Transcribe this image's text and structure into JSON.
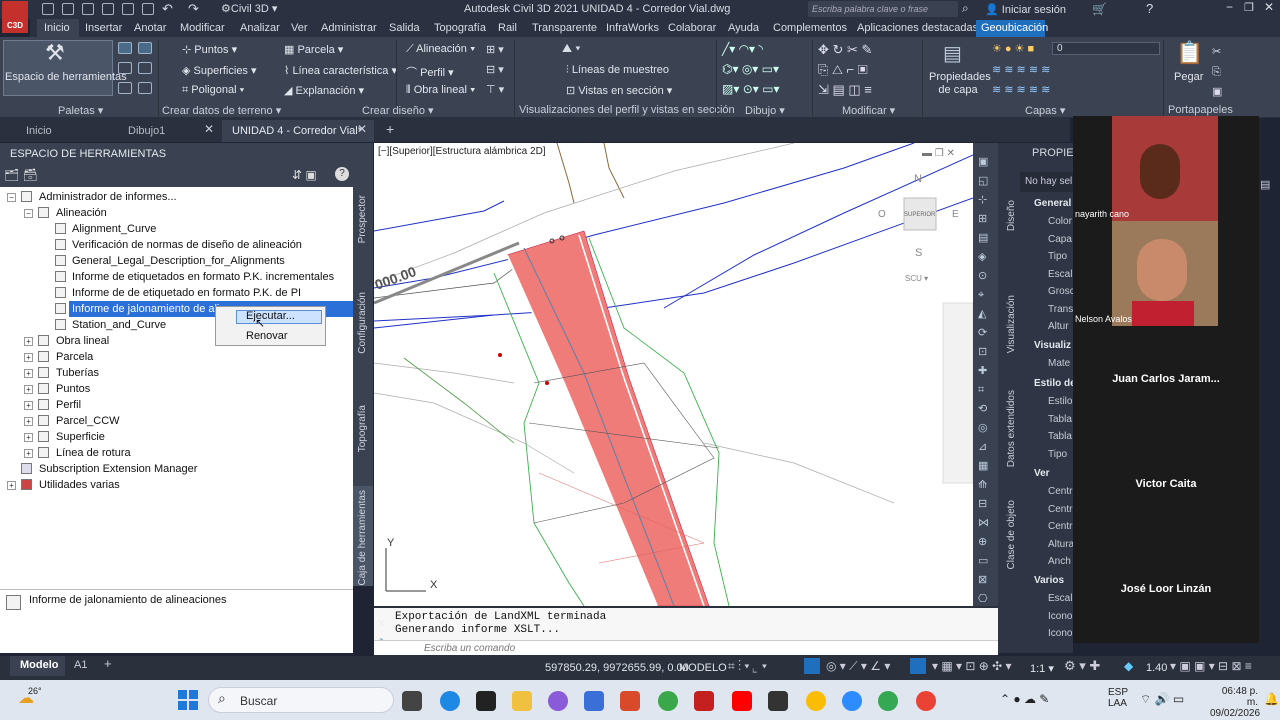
{
  "app": {
    "title": "Autodesk Civil 3D 2021   UNIDAD 4  - Corredor Vial.dwg",
    "workspace": "Civil 3D",
    "search_placeholder": "Escriba palabra clave o frase",
    "signin": "Iniciar sesión",
    "logo": "C3D"
  },
  "menu_tabs": [
    "Inicio",
    "Insertar",
    "Anotar",
    "Modificar",
    "Analizar",
    "Ver",
    "Administrar",
    "Salida",
    "Topografía",
    "Rail",
    "Transparente",
    "InfraWorks",
    "Colaborar",
    "Ayuda",
    "Complementos",
    "Aplicaciones destacadas",
    "Geoubicación"
  ],
  "ribbon": {
    "toolspace_button": "Espacio de herramientas",
    "paletas": "Paletas",
    "crear_datos": {
      "items": [
        "Puntos",
        "Superficies",
        "Poligonal",
        "Parcela",
        "Línea característica",
        "Explanación"
      ],
      "footer": "Crear datos de terreno"
    },
    "crear_diseno": {
      "items": [
        "Alineación",
        "Perfil",
        "Obra lineal"
      ],
      "footer": "Crear diseño"
    },
    "visualizaciones": {
      "items": [
        "Líneas de muestreo",
        "Vistas en sección"
      ],
      "footer": "Visualizaciones del perfil y vistas en sección"
    },
    "dibujo": "Dibujo",
    "modificar": "Modificar",
    "capas": {
      "button": "Propiedades de capa",
      "footer": "Capas",
      "layer_value": "0"
    },
    "portapapeles": {
      "button": "Pegar",
      "footer": "Portapapeles"
    }
  },
  "doc_tabs": [
    "Inicio",
    "Dibujo1",
    "UNIDAD 4  - Corredor Vial*"
  ],
  "toolspace": {
    "header": "ESPACIO DE HERRAMIENTAS",
    "tree": {
      "root": "Administrador de informes...",
      "alineacion": "Alineación",
      "alignment_reports": [
        "Alignment_Curve",
        "Verificación de normas de diseño de alineación",
        "General_Legal_Description_for_Alignments",
        "Informe de etiquetados en formato P.K. incrementales",
        "Informe de de etiquetado en formato P.K. de PI",
        "Informe de jalonamiento de alineaciones",
        "Station_and_Curve"
      ],
      "categories": [
        "Obra lineal",
        "Parcela",
        "Tuberías",
        "Puntos",
        "Perfil",
        "Parcel_CCW",
        "Superficie",
        "Línea de rotura"
      ],
      "subscription": "Subscription Extension Manager",
      "utilidades": "Utilidades varias"
    },
    "selected_visible": "Informe de jalonamiento de alin",
    "context_menu": [
      "Ejecutar...",
      "Renovar"
    ],
    "description": "Informe de jalonamiento de alineaciones",
    "side_tabs": [
      "Prospector",
      "Configuración",
      "Topografía",
      "Caja de herramientas"
    ]
  },
  "viewport": {
    "label": "[−][Superior][Estructura alámbrica 2D]",
    "station_text": "000.00",
    "viewcube": {
      "top": "SUPERIOR",
      "n": "N",
      "s": "S",
      "e": "E",
      "o": "O",
      "ucs": "SCU"
    },
    "axis_y": "Y",
    "axis_x": "X"
  },
  "command": {
    "history": [
      "Exportación de LandXML terminada",
      "Generando informe XSLT..."
    ],
    "placeholder": "Escriba un comando"
  },
  "properties": {
    "title": "PROPIED",
    "no_selection": "No hay sel",
    "side_tabs": [
      "Diseño",
      "Visualización",
      "Datos extendidos",
      "Clase de objeto"
    ],
    "sections": [
      {
        "name": "General",
        "rows": [
          "Color",
          "Capa",
          "Tipo",
          "Escal",
          "Grosc",
          "Trans",
          "Altur"
        ]
      },
      {
        "name": "Visualiz",
        "rows": [
          "Mate"
        ]
      },
      {
        "name": "Estilo de",
        "rows": [
          "Estilo",
          "Tabla",
          "Tabla",
          "Tipo"
        ]
      },
      {
        "name": "Ver",
        "rows": [
          "Centr",
          "Centr",
          "Centr",
          "Altura",
          "Anch"
        ]
      },
      {
        "name": "Varios",
        "rows": [
          "Escal",
          "Icono",
          "Icono"
        ]
      }
    ]
  },
  "video": {
    "participants": [
      "nayarith cano",
      "Nelson Avalos",
      "Juan Carlos Jaram...",
      "Victor Caita",
      "José Loor Linzán"
    ]
  },
  "status": {
    "tabs": [
      "Modelo",
      "A1"
    ],
    "coords": "597850.29, 9972655.99, 0.00",
    "mode": "MODELO",
    "scale": "1:1",
    "zoom": "1.40"
  },
  "taskbar": {
    "search": "Buscar",
    "weather": "26°",
    "lang": "ESP",
    "lang2": "LAA",
    "time": "06:48 p. m.",
    "date": "09/02/2026"
  }
}
